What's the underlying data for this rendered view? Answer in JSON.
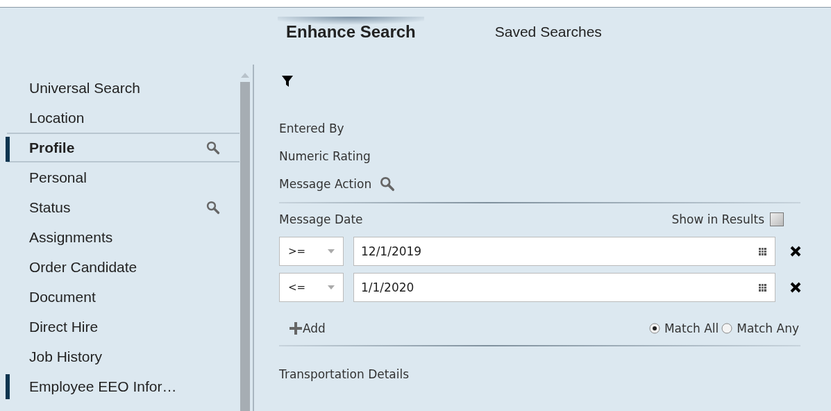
{
  "tabs": [
    {
      "label": "Enhance Search",
      "selected": true
    },
    {
      "label": "Saved Searches",
      "selected": false
    }
  ],
  "sidebar": {
    "items": [
      {
        "label": "Universal Search",
        "selected": false,
        "marked": false,
        "searchable": false
      },
      {
        "label": "Location",
        "selected": false,
        "marked": false,
        "searchable": false
      },
      {
        "label": "Profile",
        "selected": true,
        "marked": true,
        "searchable": true
      },
      {
        "label": "Personal",
        "selected": false,
        "marked": false,
        "searchable": false
      },
      {
        "label": "Status",
        "selected": false,
        "marked": false,
        "searchable": true
      },
      {
        "label": "Assignments",
        "selected": false,
        "marked": false,
        "searchable": false
      },
      {
        "label": "Order Candidate",
        "selected": false,
        "marked": false,
        "searchable": false
      },
      {
        "label": "Document",
        "selected": false,
        "marked": false,
        "searchable": false
      },
      {
        "label": "Direct Hire",
        "selected": false,
        "marked": false,
        "searchable": false
      },
      {
        "label": "Job History",
        "selected": false,
        "marked": false,
        "searchable": false
      },
      {
        "label": "Employee EEO Infor…",
        "selected": false,
        "marked": true,
        "searchable": false
      }
    ]
  },
  "fields": [
    {
      "label": "Entered By",
      "searchable": false
    },
    {
      "label": "Numeric Rating",
      "searchable": false
    },
    {
      "label": "Message Action",
      "searchable": true
    }
  ],
  "date_filter": {
    "label": "Message Date",
    "show_in_results_label": "Show in Results",
    "show_in_results": false,
    "conditions": [
      {
        "operator": ">=",
        "value": "12/1/2019"
      },
      {
        "operator": "<=",
        "value": "1/1/2020"
      }
    ],
    "add_label": "Add",
    "match": [
      {
        "label": "Match All",
        "selected": true
      },
      {
        "label": "Match Any",
        "selected": false
      }
    ]
  },
  "next_section": "Transportation Details"
}
